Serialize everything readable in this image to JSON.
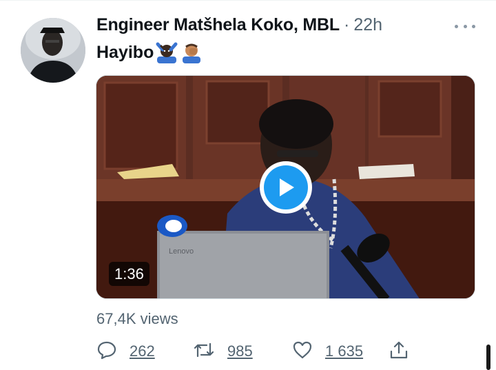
{
  "tweet": {
    "author": "Engineer Matšhela Koko, MBL",
    "separator": "·",
    "time": "22h",
    "text": "Hayibo",
    "emojis": [
      "person-gesturing-no-emoji",
      "person-facepalming-emoji"
    ]
  },
  "media": {
    "duration": "1:36",
    "play_icon": "play-icon",
    "laptop_label": "Lenovo"
  },
  "views_text": "67,4K views",
  "actions": {
    "replies": "262",
    "retweets": "985",
    "likes": "1 635",
    "reply_icon": "reply-icon",
    "retweet_icon": "retweet-icon",
    "like_icon": "heart-icon",
    "share_icon": "share-icon"
  },
  "colors": {
    "accent": "#1d9bf0",
    "text_primary": "#0f1419",
    "text_secondary": "#536471"
  }
}
